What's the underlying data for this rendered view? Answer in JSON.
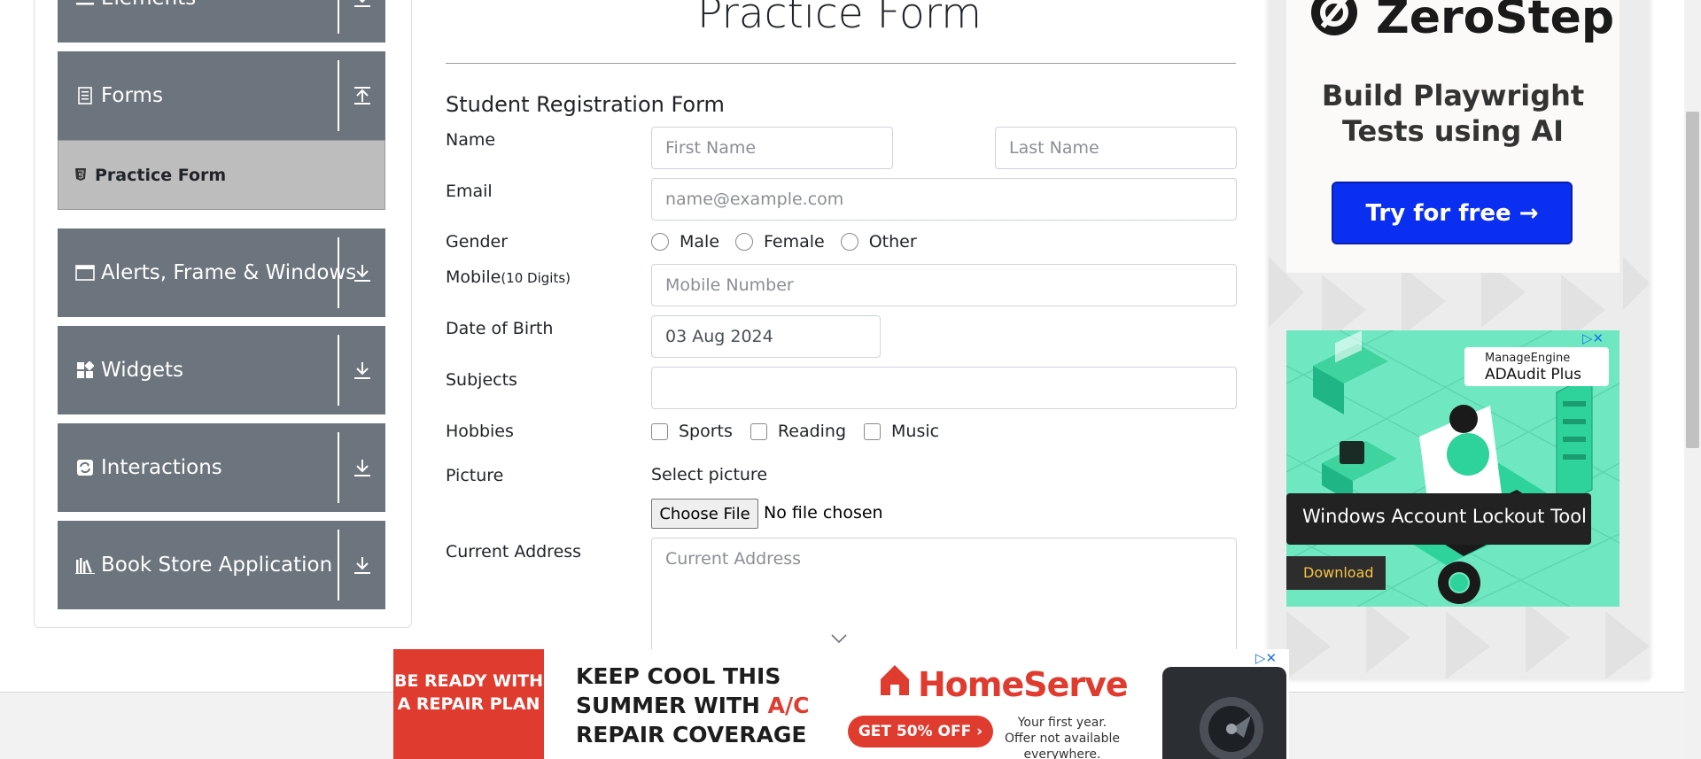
{
  "sidebar": {
    "groups": [
      {
        "label": "Elements",
        "icon": "list-icon",
        "arrow": "download-arrow-icon"
      },
      {
        "label": "Forms",
        "icon": "form-doc-icon",
        "arrow": "upload-arrow-icon"
      },
      {
        "label": "Alerts, Frame & Windows",
        "icon": "window-icon",
        "arrow": "download-arrow-icon"
      },
      {
        "label": "Widgets",
        "icon": "widgets-icon",
        "arrow": "download-arrow-icon"
      },
      {
        "label": "Interactions",
        "icon": "interactions-icon",
        "arrow": "download-arrow-icon"
      },
      {
        "label": "Book Store Application",
        "icon": "books-icon",
        "arrow": "download-arrow-icon"
      }
    ],
    "active_item": {
      "label": "Practice Form",
      "icon": "html5-icon"
    }
  },
  "main": {
    "page_title": "Practice Form",
    "form_heading": "Student Registration Form",
    "name_label": "Name",
    "first_name_placeholder": "First Name",
    "last_name_placeholder": "Last Name",
    "email_label": "Email",
    "email_placeholder": "name@example.com",
    "gender_label": "Gender",
    "gender_options": [
      "Male",
      "Female",
      "Other"
    ],
    "mobile_label": "Mobile",
    "mobile_hint": "(10 Digits)",
    "mobile_placeholder": "Mobile Number",
    "dob_label": "Date of Birth",
    "dob_value": "03 Aug 2024",
    "subjects_label": "Subjects",
    "hobbies_label": "Hobbies",
    "hobby_options": [
      "Sports",
      "Reading",
      "Music"
    ],
    "picture_label": "Picture",
    "select_picture_label": "Select picture",
    "choose_file_label": "Choose File",
    "no_file_text": "No file chosen",
    "address_label": "Current Address",
    "address_placeholder": "Current Address"
  },
  "ads": {
    "zerostep": {
      "brand": "ZeroStep",
      "tagline": "Build Playwright Tests using AI",
      "button": "Try for free →",
      "button_color": "#0a2ff0"
    },
    "adaudit": {
      "vendor": "ManageEngine",
      "product": "ADAudit Plus",
      "headline": "Windows Account Lockout Tool",
      "cta": "Download",
      "bg_color": "#6fe8c2"
    },
    "homeserve": {
      "left_text": "BE READY WITH A REPAIR PLAN",
      "headline_1": "KEEP COOL THIS",
      "headline_2a": "SUMMER WITH ",
      "headline_2b": "A/C",
      "headline_3": "REPAIR COVERAGE",
      "brand": "HomeServe",
      "offer": "GET 50% OFF ›",
      "note": "Your first year. Offer not available everywhere.",
      "accent_color": "#e03b2f"
    },
    "ad_close_glyphs": "▷✕"
  },
  "colors": {
    "sidebar_group": "#6c757d",
    "sidebar_active": "#bdbdbd",
    "text": "#212529"
  }
}
